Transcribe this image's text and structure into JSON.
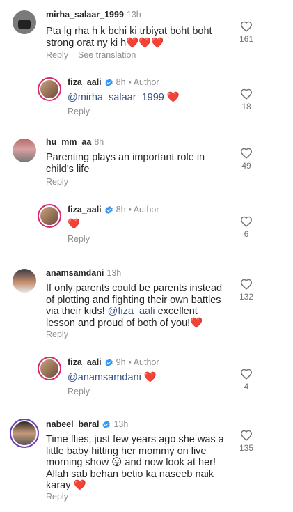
{
  "comments": [
    {
      "username": "mirha_salaar_1999",
      "time": "13h",
      "text": "Pta lg rha h k bchi ki trbiyat boht boht strong orat ny ki h❤️❤️❤️",
      "reply_label": "Reply",
      "translate_label": "See translation",
      "likes": "161"
    },
    {
      "username": "fiza_aali",
      "time": "8h",
      "author": "• Author",
      "mention": "@mirha_salaar_1999",
      "text": " ❤️",
      "reply_label": "Reply",
      "likes": "18"
    },
    {
      "username": "hu_mm_aa",
      "time": "8h",
      "text": "Parenting plays an important role in child's life",
      "reply_label": "Reply",
      "likes": "49"
    },
    {
      "username": "fiza_aali",
      "time": "8h",
      "author": "• Author",
      "text": "❤️",
      "reply_label": "Reply",
      "likes": "6"
    },
    {
      "username": "anamsamdani",
      "time": "13h",
      "text_before": "If only parents could be parents instead of plotting and fighting their own battles via their kids! ",
      "mention": "@fiza_aali",
      "text_after": " excellent lesson and proud of both of you!❤️",
      "reply_label": "Reply",
      "likes": "132"
    },
    {
      "username": "fiza_aali",
      "time": "9h",
      "author": "• Author",
      "mention": "@anamsamdani",
      "text": " ❤️",
      "reply_label": "Reply",
      "likes": "4"
    },
    {
      "username": "nabeel_baral",
      "time": "13h",
      "text": "Time flies, just few years ago she was a little baby hitting her mommy on live morning show 😛 and now look at her! Allah sab behan betio ka naseeb naik karay ❤️",
      "reply_label": "Reply",
      "likes": "135"
    }
  ],
  "colors": {
    "verified": "#3897f0",
    "mention": "#385185",
    "story_ring": "#d62976"
  },
  "icons": {
    "like": "heart-outline-icon",
    "verified": "verified-badge-icon"
  }
}
